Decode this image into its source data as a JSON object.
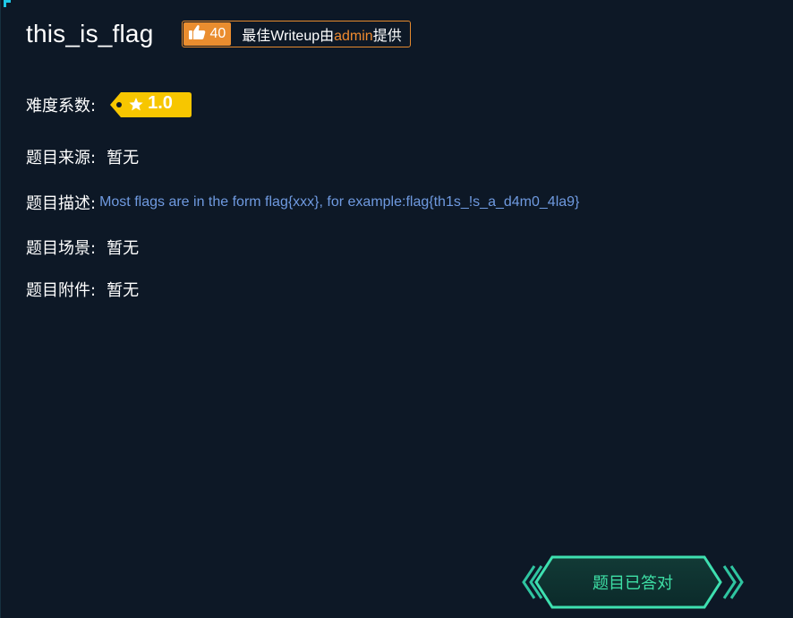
{
  "challenge": {
    "title": "this_is_flag",
    "likes": "40",
    "writeup_prefix": "最佳Writeup由",
    "writeup_author": "admin",
    "writeup_suffix": "提供"
  },
  "fields": {
    "difficulty_label": "难度系数:",
    "difficulty_value": "1.0",
    "source_label": "题目来源:",
    "source_value": "暂无",
    "description_label": "题目描述:",
    "description_value": "Most flags are in the form flag{xxx}, for example:flag{th1s_!s_a_d4m0_4la9}",
    "scene_label": "题目场景:",
    "scene_value": "暂无",
    "attachment_label": "题目附件:",
    "attachment_value": "暂无"
  },
  "status": {
    "solved_label": "题目已答对"
  },
  "colors": {
    "background": "#0d1826",
    "accent_orange": "#ea8d2f",
    "difficulty_yellow": "#f7c600",
    "description_blue": "#6f9ae0",
    "solved_green": "#3ee0a6"
  },
  "icons": {
    "like": "thumbs-up-icon",
    "star": "star-icon"
  }
}
